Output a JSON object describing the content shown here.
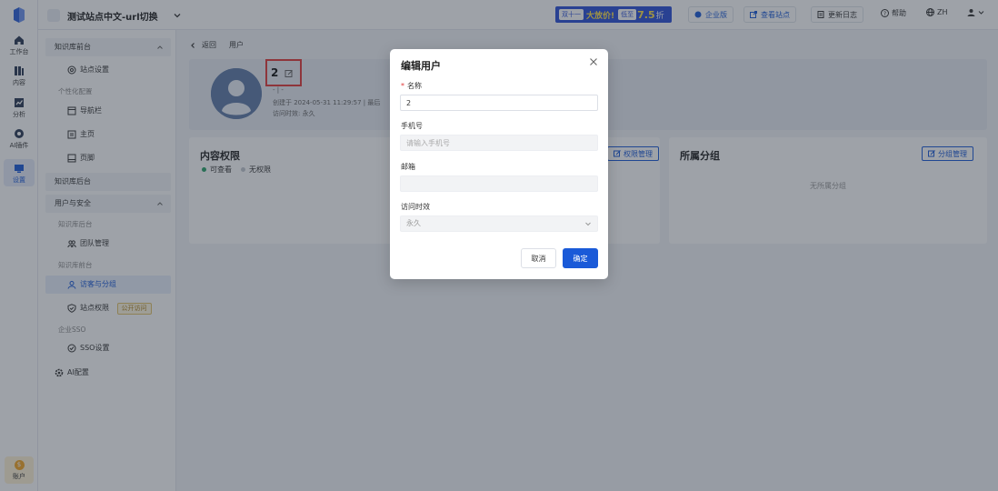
{
  "rail": {
    "items": [
      {
        "label": "工作台",
        "icon": "home-icon"
      },
      {
        "label": "内容",
        "icon": "content-icon"
      },
      {
        "label": "分析",
        "icon": "analytics-icon"
      },
      {
        "label": "AI插件",
        "icon": "plugin-icon"
      },
      {
        "label": "设置",
        "icon": "settings-icon"
      }
    ],
    "account_label": "账户"
  },
  "topbar": {
    "site_name": "测试站点中文-url切换",
    "promo": {
      "tag": "双十一",
      "text": "大放价!",
      "disc_tag": "低至",
      "num": "7.5",
      "suffix": "折"
    },
    "enterprise_label": "企业版",
    "visit_site_label": "查看站点",
    "changelog_label": "更新日志",
    "help_label": "帮助",
    "lang_label": "ZH"
  },
  "sidenav": {
    "group_front": "知识库前台",
    "site_settings": "站点设置",
    "personalize": "个性化配置",
    "navbar": "导航栏",
    "homepage": "主页",
    "footer": "页脚",
    "group_back": "知识库后台",
    "group_users": "用户与安全",
    "sub_kb_back": "知识库后台",
    "team_manage": "团队管理",
    "sub_kb_front": "知识库前台",
    "visitors_groups": "访客与分组",
    "site_permission": "站点权限",
    "public_badge": "公开访问",
    "sub_enterprise_sso": "企业SSO",
    "sso_settings": "SSO设置",
    "ai_config": "AI配置"
  },
  "content": {
    "back_label": "返回",
    "breadcrumb_current": "用户",
    "profile": {
      "name": "2",
      "dashes": "-   |   -",
      "created": "创建于 2024-05-31 11:29:57   |   最后",
      "access": "访问时效: 永久"
    },
    "perm_panel": {
      "title": "内容权限",
      "btn": "权限管理",
      "legend_view": "可查看",
      "legend_none": "无权限"
    },
    "group_panel": {
      "title": "所属分组",
      "btn": "分组管理",
      "empty": "无所属分组"
    }
  },
  "modal": {
    "title": "编辑用户",
    "name_label": "名称",
    "name_value": "2",
    "phone_label": "手机号",
    "phone_placeholder": "请输入手机号",
    "email_label": "邮箱",
    "email_value": "",
    "access_label": "访问时效",
    "access_value": "永久",
    "cancel_label": "取消",
    "ok_label": "确定"
  },
  "colors": {
    "primary": "#1a5ad8",
    "legend_view": "#2aa36b",
    "legend_none": "#c4c8d0",
    "highlight": "#e23a3a"
  }
}
